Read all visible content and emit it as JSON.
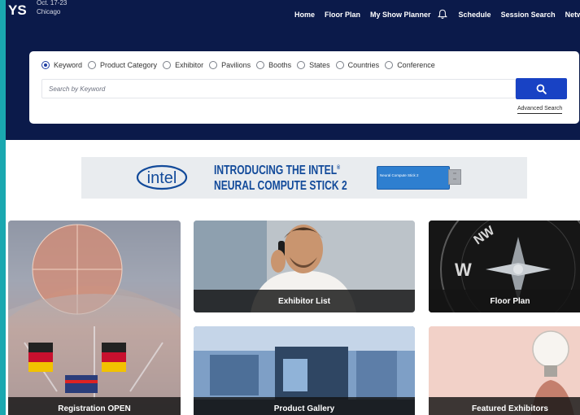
{
  "header": {
    "logo_text": "YS",
    "date_line": "Oct. 17-23",
    "city": "Chicago",
    "background": "#0b1a4a",
    "nav": {
      "home": "Home",
      "floor_plan": "Floor Plan",
      "my_show_planner": "My Show Planner",
      "schedule": "Schedule",
      "session_search": "Session Search",
      "networking": "Netw"
    }
  },
  "search": {
    "options": [
      "Keyword",
      "Product Category",
      "Exhibitor",
      "Pavilions",
      "Booths",
      "States",
      "Countries",
      "Conference"
    ],
    "selected": "Keyword",
    "placeholder": "Search by Keyword",
    "value": "",
    "advanced_search": "Advanced Search",
    "button_icon": "search-icon",
    "button_color": "#1842c4"
  },
  "banner": {
    "brand": "intel",
    "headline_line1": "INTRODUCING THE INTEL",
    "trademark": "®",
    "headline_line2": "NEURAL COMPUTE STICK 2",
    "product_label": "Neural Compute Stick 2",
    "brand_color": "#124a9a"
  },
  "tiles": {
    "registration": "Registration OPEN",
    "exhibitor_list": "Exhibitor List",
    "floor_plan": "Floor Plan",
    "product_gallery": "Product Gallery",
    "featured_exhibitors": "Featured Exhibitors",
    "compass_letter_w": "W",
    "compass_letter_nw": "NW"
  },
  "colors": {
    "frame_border": "#1aa8b0"
  }
}
